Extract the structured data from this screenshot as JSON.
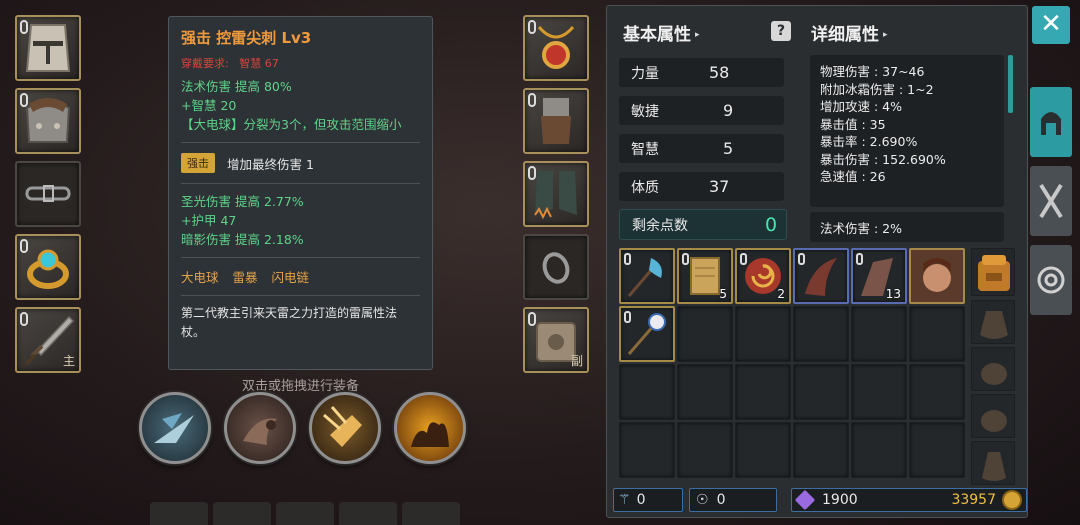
{
  "equipment_left": {
    "weapon_tag": "主"
  },
  "equipment_right": {
    "offhand_tag": "副"
  },
  "tooltip": {
    "title": "强击 控雷尖刺 Lv3",
    "requirement_label": "穿戴要求:",
    "requirement_value": "智慧 67",
    "base_stats": [
      "法术伤害 提高 80%",
      "+智慧 20",
      "【大电球】分裂为3个，但攻击范围缩小"
    ],
    "enhance_badge": "强击",
    "enhance_text": "增加最终伤害 1",
    "extra_stats": [
      "圣光伤害 提高 2.77%",
      "+护甲 47",
      "暗影伤害 提高 2.18%"
    ],
    "skills": [
      "大电球",
      "雷暴",
      "闪电链"
    ],
    "description": "第二代教主引来天雷之力打造的雷属性法杖。"
  },
  "hint": "双击或拖拽进行装备",
  "panel": {
    "basic_header": "基本属性",
    "detail_header": "详细属性",
    "stats": [
      {
        "label": "力量",
        "value": "58"
      },
      {
        "label": "敏捷",
        "value": "9"
      },
      {
        "label": "智慧",
        "value": "5"
      },
      {
        "label": "体质",
        "value": "37"
      }
    ],
    "points_label": "剩余点数",
    "points_value": "0",
    "details": [
      "物理伤害 : 37~46",
      "附加冰霜伤害 : 1~2",
      "增加攻速 : 4%",
      "暴击值 : 35",
      "暴击率 : 2.690%",
      "暴击伤害 : 152.690%",
      "急速值 : 26"
    ],
    "detail_extra": "法术伤害 : 2%",
    "inventory_counts": {
      "scroll": "5",
      "orb": "2",
      "shard": "13"
    }
  },
  "footer": {
    "wand_count": "0",
    "potion_count": "0",
    "crystal_count": "1900",
    "gold_count": "33957"
  },
  "colors": {
    "accent": "#36a8b2",
    "gold_border": "#a68a47",
    "title_orange": "#f09a3c",
    "stat_green": "#5fd38a"
  }
}
